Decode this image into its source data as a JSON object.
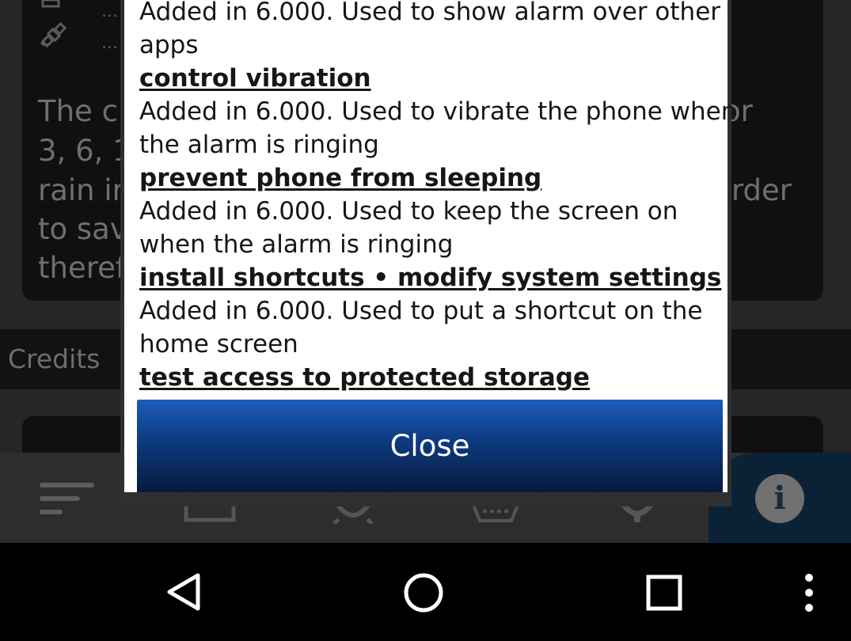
{
  "background": {
    "row_dots": [
      "...",
      "..."
    ],
    "paragraph_lines": [
      {
        "left": "The c",
        "right": "or"
      },
      {
        "left": "3, 6, 1",
        "right": ""
      },
      {
        "left": "rain ir",
        "right": "rder"
      },
      {
        "left": "to sav",
        "right": ""
      },
      {
        "left": "theref",
        "right": ""
      }
    ],
    "section_label": "Credits"
  },
  "dialog": {
    "lines": [
      {
        "text": "Added in 6.000. Used to show alarm over other",
        "bold": false
      },
      {
        "text": "apps",
        "bold": false
      },
      {
        "text": "control vibration",
        "bold": true
      },
      {
        "text": "Added in 6.000. Used to vibrate the phone when",
        "bold": false
      },
      {
        "text": "the alarm is ringing",
        "bold": false
      },
      {
        "text": "prevent phone from sleeping",
        "bold": true
      },
      {
        "text": "Added in 6.000. Used to keep the screen on",
        "bold": false
      },
      {
        "text": "when the alarm is ringing",
        "bold": false
      },
      {
        "text": "install shortcuts • modify system settings",
        "bold": true
      },
      {
        "text": "Added in 6.000. Used to put a shortcut on the",
        "bold": false
      },
      {
        "text": "home screen",
        "bold": false
      },
      {
        "text": "test access to protected storage",
        "bold": true
      }
    ],
    "close_label": "Close"
  },
  "toolbar": {
    "icons": [
      "sort-icon",
      "map-icon",
      "alarm-icon",
      "keyboard-icon",
      "settings-icon",
      "info-icon"
    ],
    "info_glyph": "i"
  },
  "navbar": {
    "icons": [
      "back-icon",
      "home-icon",
      "recents-icon",
      "overflow-menu-icon"
    ]
  },
  "colors": {
    "dialog_bg": "#ffffff",
    "close_button": "#0e3a7f",
    "navbar": "#000000",
    "background": "#262626"
  }
}
